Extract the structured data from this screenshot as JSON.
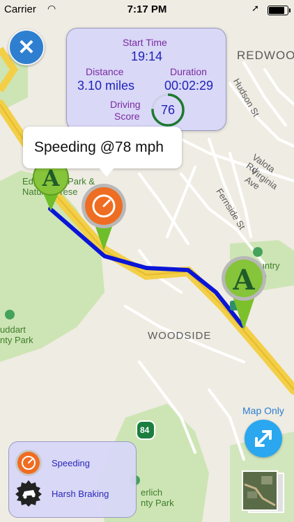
{
  "status_bar": {
    "carrier": "Carrier",
    "time": "7:17 PM"
  },
  "trip": {
    "start_time_label": "Start Time",
    "start_time": "19:14",
    "distance_label": "Distance",
    "distance": "3.10 miles",
    "duration_label": "Duration",
    "duration": "00:02:29",
    "score_label_1": "Driving",
    "score_label_2": "Score",
    "score": "76",
    "score_fraction": 0.76
  },
  "callout": {
    "text": "Speeding @78 mph"
  },
  "map_labels": {
    "redwood": "REDWOO",
    "hudson": "Hudson St",
    "valota": "Valota Rd",
    "virginia": "Virginia Ave",
    "fernside": "Fernside St",
    "edgewood_1": "Edgewood Park &",
    "edgewood_2": "Natural Prese",
    "country_club": "Country Club",
    "woodside": "WOODSIDE",
    "huddart_1": "uddart",
    "huddart_2": "nty Park",
    "highway": "84",
    "wunderlich_1": "erlich",
    "wunderlich_2": "nty Park"
  },
  "controls": {
    "map_only": "Map Only"
  },
  "legend": {
    "speeding": "Speeding",
    "harsh_braking": "Harsh Braking"
  },
  "colors": {
    "route": "#0a15d6",
    "accent_blue": "#2f7fd1",
    "card_bg": "#d7d7f8",
    "label_purple": "#7a2aa0",
    "value_blue": "#1f23b8",
    "pin_green": "#1f7a2a",
    "speed_orange": "#ef6d22",
    "score_green": "#1d7a30"
  },
  "icons": {
    "close": "close-icon",
    "speeding": "speedometer-icon",
    "harsh_braking": "car-braking-icon",
    "pin_start": "start-pin-icon",
    "pin_end": "end-pin-icon",
    "expand": "expand-arrows-icon"
  }
}
